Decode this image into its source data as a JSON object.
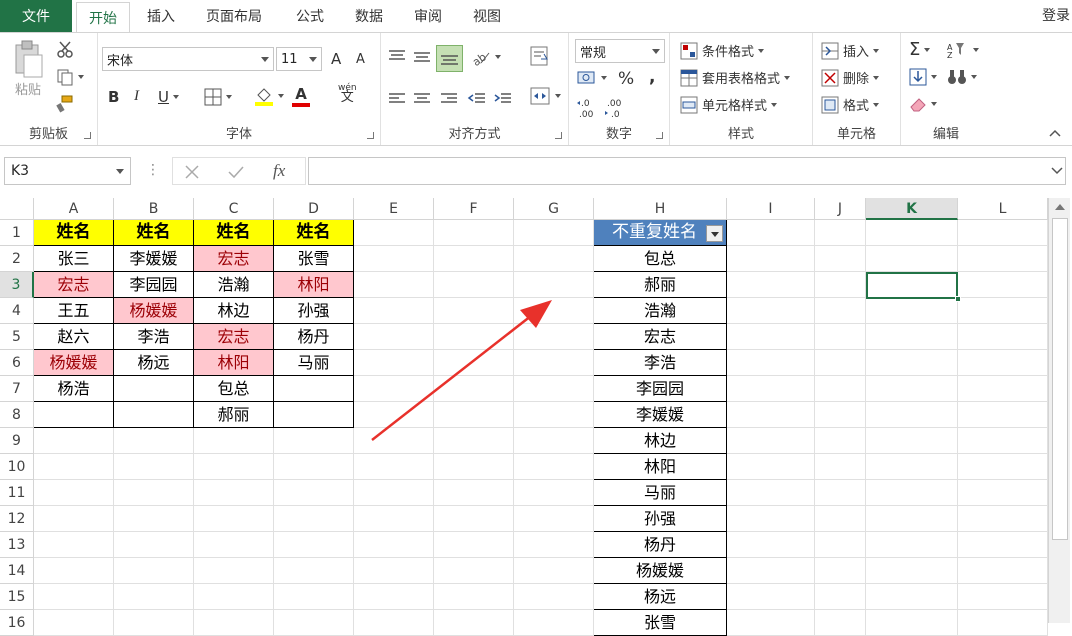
{
  "tabs": {
    "file": "文件",
    "home": "开始",
    "insert": "插入",
    "layout": "页面布局",
    "formula": "公式",
    "data": "数据",
    "review": "审阅",
    "view": "视图",
    "login": "登录"
  },
  "ribbon": {
    "clipboard": {
      "paste": "粘贴",
      "label": "剪贴板"
    },
    "font": {
      "name": "宋体",
      "size": "11",
      "label": "字体",
      "bold": "B",
      "italic": "I",
      "underline": "U",
      "grow": "A",
      "shrink": "A",
      "wen": "wén",
      "wenchar": "文",
      "fontcolor": "A"
    },
    "align": {
      "label": "对齐方式"
    },
    "number": {
      "format": "常规",
      "percent": "%",
      "comma": ",",
      "inc": ".0←.00",
      "dec": ".00→.0",
      "label": "数字"
    },
    "styles": {
      "cond": "条件格式",
      "table": "套用表格格式",
      "cell": "单元格样式",
      "label": "样式"
    },
    "cells": {
      "insert": "插入",
      "delete": "删除",
      "format": "格式",
      "label": "单元格"
    },
    "edit": {
      "sum": "Σ",
      "label": "编辑"
    }
  },
  "formula_bar": {
    "name_box": "K3",
    "fx": "fx",
    "content": ""
  },
  "columns": [
    "A",
    "B",
    "C",
    "D",
    "E",
    "F",
    "G",
    "H",
    "I",
    "J",
    "K",
    "L"
  ],
  "rows": [
    "1",
    "2",
    "3",
    "4",
    "5",
    "6",
    "7",
    "8",
    "9",
    "10",
    "11",
    "12",
    "13",
    "14",
    "15",
    "16"
  ],
  "selected_cell": "K3",
  "table1": {
    "headers": [
      "姓名",
      "姓名",
      "姓名",
      "姓名"
    ],
    "rows": [
      [
        "张三",
        "李媛媛",
        "宏志",
        "张雪"
      ],
      [
        "宏志",
        "李园园",
        "浩瀚",
        "林阳"
      ],
      [
        "王五",
        "杨媛媛",
        "林边",
        "孙强"
      ],
      [
        "赵六",
        "李浩",
        "宏志",
        "杨丹"
      ],
      [
        "杨媛媛",
        "杨远",
        "林阳",
        "马丽"
      ],
      [
        "杨浩",
        "",
        "包总",
        ""
      ],
      [
        "",
        "",
        "郝丽",
        ""
      ]
    ],
    "highlight": [
      [
        1,
        0
      ],
      [
        0,
        2
      ],
      [
        1,
        3
      ],
      [
        2,
        1
      ],
      [
        3,
        2
      ],
      [
        4,
        0
      ],
      [
        4,
        2
      ]
    ]
  },
  "table2": {
    "header": "不重复姓名",
    "values": [
      "包总",
      "郝丽",
      "浩瀚",
      "宏志",
      "李浩",
      "李园园",
      "李媛媛",
      "林边",
      "林阳",
      "马丽",
      "孙强",
      "杨丹",
      "杨媛媛",
      "杨远",
      "张雪"
    ]
  },
  "colors": {
    "accent": "#217346",
    "header_yellow": "#ffff00",
    "dup_fill": "#ffc7ce",
    "dup_text": "#9c0006",
    "table_header": "#4f81bd",
    "arrow": "#e8312b"
  }
}
